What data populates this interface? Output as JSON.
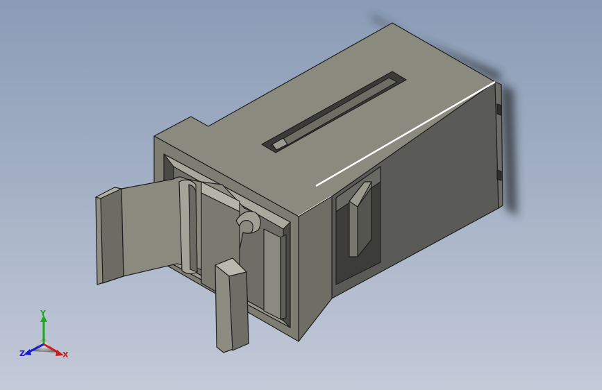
{
  "viewport": {
    "background_top": "#8a9cb6",
    "background_bottom": "#c3cad8",
    "model_color": "#8c8c80",
    "model_edge_color": "#1e1e1e"
  },
  "triad": {
    "x_label": "X",
    "y_label": "Y",
    "z_label": "Z",
    "x_color": "#d11a1a",
    "y_color": "#1aaa1a",
    "z_color": "#1a1ad1"
  }
}
